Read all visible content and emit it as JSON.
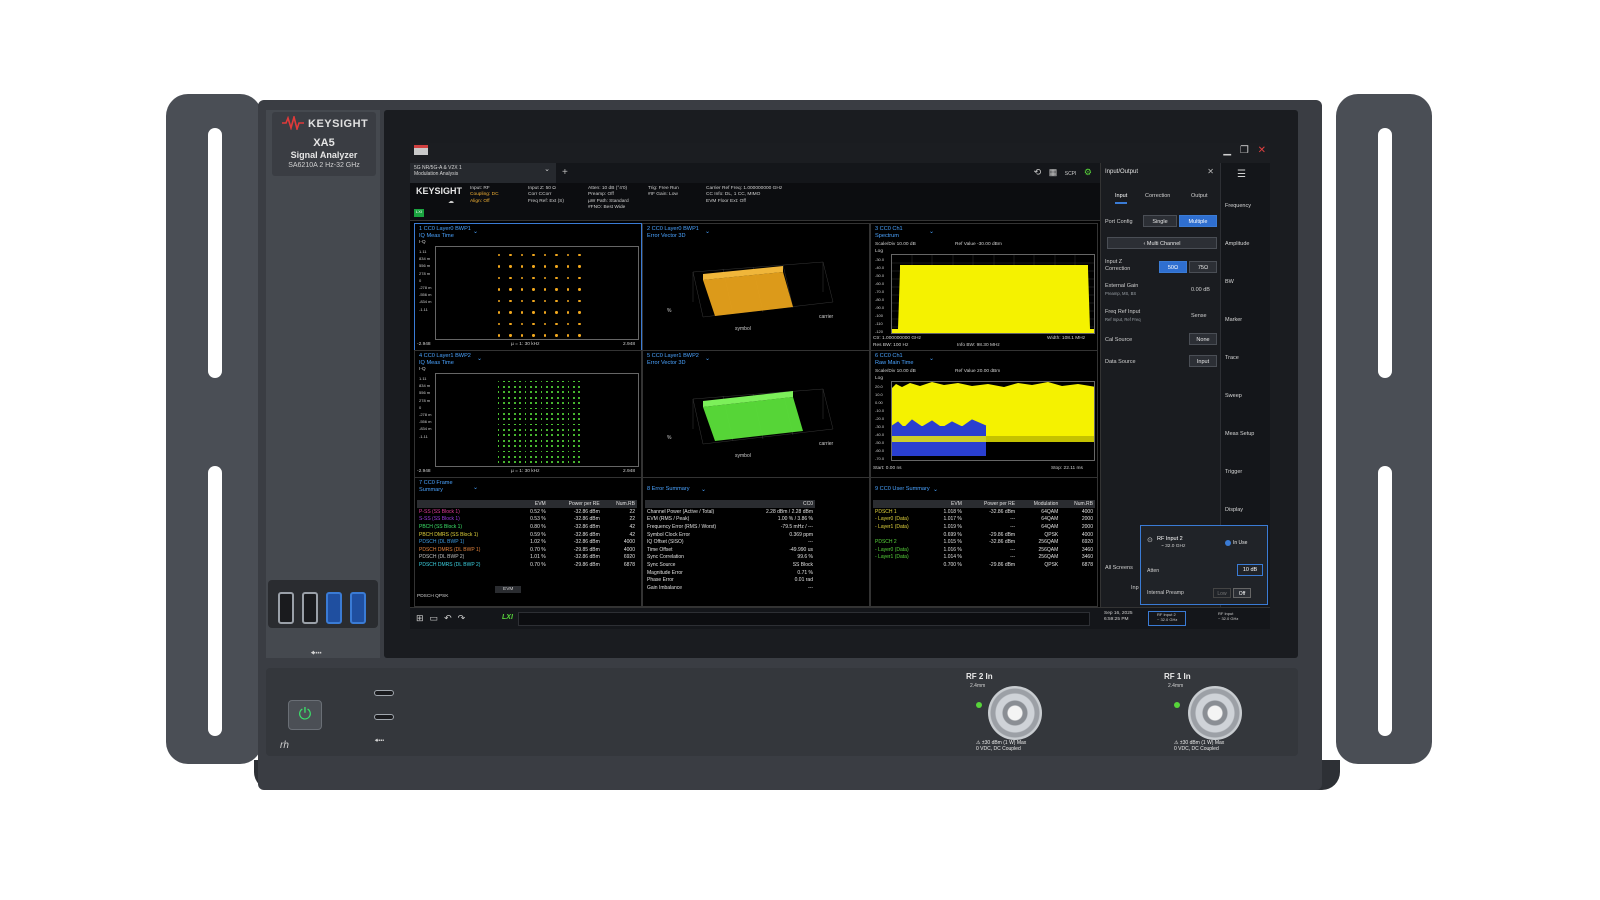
{
  "device": {
    "brand": "KEYSIGHT",
    "model": "XA5",
    "title": "Signal Analyzer",
    "spec": "SA6210A   2 Hz-32 GHz",
    "rh_mark": "rh",
    "front_inputs": [
      {
        "label": "RF 2 In",
        "sub": "2.4mm",
        "warning_1": "±30 dBm (1 W) Max",
        "warning_2": "0 VDC, DC Coupled"
      },
      {
        "label": "RF 1 In",
        "sub": "2.4mm",
        "warning_1": "±30 dBm (1 W) Max",
        "warning_2": "0 VDC, DC Coupled"
      }
    ]
  },
  "screen": {
    "mode_tab": {
      "line1": "5G NR/5G-A & V2X 1",
      "line2": "Modulation Analysis"
    },
    "settings_logo": "KEYSIGHT",
    "lxi": "LXI",
    "settings_groups": [
      {
        "lines": [
          "Input: RF",
          "Coupling: DC",
          "Align: Off"
        ],
        "highlight": [
          1,
          2
        ]
      },
      {
        "lines": [
          "Input Z: 50 Ω",
          "Corr CCorr",
          "Freq Ref: Ext (S)"
        ],
        "highlight": []
      },
      {
        "lines": [
          "Atten: 10 dB (°4'0)",
          "Preamp: Off",
          "µW Path: Standard",
          "#FNO: Best Wide"
        ],
        "highlight": []
      },
      {
        "lines": [
          "Trig: Free Run",
          "#IF Gain: Low"
        ],
        "highlight": []
      },
      {
        "lines": [
          "Carrier Ref Freq: 1.000000000 GHz",
          "CC Info: DL, 1 CC, MIMO",
          "EVM Floor Ext: Off"
        ],
        "highlight": []
      }
    ],
    "panes": [
      {
        "title": "1 CC0 Layer0 BWP1",
        "sub": "IQ Meas Time",
        "footer_left": "-2.948",
        "footer_mid": "µ = 1: 30 kHz",
        "footer_right": "2.948",
        "yaxis_label": "I-Q"
      },
      {
        "title": "2 CC0 Layer0 BWP1",
        "sub": "Error Vector 3D",
        "x_label": "symbol",
        "z_label": "carrier",
        "y_label": "%"
      },
      {
        "title": "3 CC0 Ch1",
        "sub": "Spectrum",
        "scale": "Scale/Div 10.00 dB",
        "ref": "Ref Value -30.00 dBm",
        "ctr": "Ctr: 1.000000000 GHz",
        "res_bw": "Res BW: 100 Hz",
        "info_bw": "Info BW: 98.30 MHz",
        "width": "Width: 108.1 MHz",
        "yaxis_label": "Log"
      },
      {
        "title": "4 CC0 Layer1 BWP2",
        "sub": "IQ Meas Time",
        "footer_left": "-2.948",
        "footer_mid": "µ = 1: 30 kHz",
        "footer_right": "2.948",
        "yaxis_label": "I-Q"
      },
      {
        "title": "5 CC0 Layer1 BWP2",
        "sub": "Error Vector 3D",
        "x_label": "symbol",
        "z_label": "carrier",
        "y_label": "%"
      },
      {
        "title": "6 CC0 Ch1",
        "sub": "Raw Main Time",
        "scale": "Scale/Div 10.00 dB",
        "ref": "Ref Value 20.00 dBm",
        "start": "Start: 0.00 ns",
        "stop": "Stop: 22.11 ms",
        "yaxis_label": "Log"
      }
    ],
    "iq_ticks": [
      "1.11",
      "834 m",
      "556 m",
      "278 m",
      "0",
      "-278 m",
      "-556 m",
      "-834 m",
      "-1.11"
    ],
    "spec_ticks": [
      "-30.0",
      "-40.0",
      "-50.0",
      "-60.0",
      "-70.0",
      "-80.0",
      "-90.0",
      "-100",
      "-110",
      "-120"
    ],
    "raw_ticks": [
      "20.0",
      "10.0",
      "0.00",
      "-10.0",
      "-20.0",
      "-30.0",
      "-40.0",
      "-50.0",
      "-60.0",
      "-70.0"
    ],
    "frame_summary": {
      "title": "7 CC0 Frame Summary",
      "columns": [
        "",
        "EVM",
        "Power per RE",
        "Num.RB"
      ],
      "rows": [
        [
          "P-SS (SS Block 1)",
          "0.52 %",
          "-32.86 dBm",
          "22"
        ],
        [
          "S-SS (SS Block 1)",
          "0.53 %",
          "-32.86 dBm",
          "22"
        ],
        [
          "PBCH (SS Block 1)",
          "0.80 %",
          "-32.86 dBm",
          "42"
        ],
        [
          "PBCH DMRS (SS Block 1)",
          "0.59 %",
          "-32.86 dBm",
          "42"
        ],
        [
          "PDSCH (DL BWP 1)",
          "1.02 %",
          "-32.86 dBm",
          "4000"
        ],
        [
          "PDSCH DMRS (DL BWP 1)",
          "0.70 %",
          "-29.85 dBm",
          "4000"
        ],
        [
          "PDSCH (DL BWP 2)",
          "1.01 %",
          "-32.86 dBm",
          "6920"
        ],
        [
          "PDSCH DMRS (DL BWP 2)",
          "0.70 %",
          "-29.86 dBm",
          "6878"
        ]
      ],
      "row_colors": [
        "#e23c9b",
        "#9b3ce2",
        "#3ce26a",
        "#e2d33c",
        "#3c9be2",
        "#e2823c",
        "#c0c0c0",
        "#3cd2e2"
      ],
      "footer": [
        "PDSCH QPSK",
        "EVM"
      ]
    },
    "error_summary": {
      "title": "8 Error Summary",
      "columns": [
        "",
        "CC0"
      ],
      "rows": [
        [
          "Channel Power (Active / Total)",
          "2.28 dBm / 2.28 dBm"
        ],
        [
          "EVM (RMS / Peak)",
          "1.00 % / 3.86 %"
        ],
        [
          "Frequency Error (RMS / Worst)",
          "-79.5 mHz / ---"
        ],
        [
          "Symbol Clock Error",
          "0.369 ppm"
        ],
        [
          "IQ Offset (SISO)",
          "---"
        ],
        [
          "Time Offset",
          "-49.990 us"
        ],
        [
          "Sync Correlation",
          "99.6 %"
        ],
        [
          "Sync Source",
          "SS Block"
        ],
        [
          "Magnitude Error",
          "0.71 %"
        ],
        [
          "Phase Error",
          "0.01 rad"
        ],
        [
          "Gain Imbalance",
          "---"
        ]
      ]
    },
    "user_summary": {
      "title": "9 CC0 User Summary",
      "columns": [
        "",
        "EVM",
        "Power per RE",
        "Modulation",
        "Num.RB"
      ],
      "rows": [
        [
          "PDSCH 1",
          "1.018 %",
          "-32.86 dBm",
          "64QAM",
          "4000"
        ],
        [
          "- Layer0 (Data)",
          "1.017 %",
          "---",
          "64QAM",
          "2000"
        ],
        [
          "- Layer1 (Data)",
          "1.019 %",
          "---",
          "64QAM",
          "2000"
        ],
        [
          "",
          "0.699 %",
          "-29.86 dBm",
          "QPSK",
          "4000"
        ],
        [
          "PDSCH 2",
          "1.015 %",
          "-32.86 dBm",
          "256QAM",
          "6920"
        ],
        [
          "- Layer0 (Data)",
          "1.016 %",
          "---",
          "256QAM",
          "3460"
        ],
        [
          "- Layer1 (Data)",
          "1.014 %",
          "---",
          "256QAM",
          "3460"
        ],
        [
          "",
          "0.700 %",
          "-29.86 dBm",
          "QPSK",
          "6878"
        ]
      ]
    },
    "side_panel": {
      "title": "Input/Output",
      "tabs": [
        "Input",
        "Correction",
        "Output"
      ],
      "port_config_label": "Port Config",
      "port_config_options": [
        "Single",
        "Multiple"
      ],
      "multi_channel": "Multi Channel",
      "input_z_label": "Input Z Correction",
      "input_z_options": [
        "50Ω",
        "75Ω"
      ],
      "ext_gain_label": "External Gain",
      "ext_gain_sub": "Preamp, MS, BS",
      "ext_gain_value": "0.00 dB",
      "freq_ref_label": "Freq Ref Input",
      "freq_ref_sub": "Ref Input, Ref Freq",
      "freq_ref_value": "Sense",
      "cal_source_label": "Cal Source",
      "cal_source_value": "None",
      "data_source_label": "Data Source",
      "data_source_value": "Input",
      "all_screens": "All Screens",
      "inp_stub": "Inp"
    },
    "menu": [
      "Frequency",
      "Amplitude",
      "BW",
      "Marker",
      "Trace",
      "Sweep",
      "Meas Setup",
      "Trigger",
      "Display"
    ],
    "popup": {
      "title": "RF Input 2",
      "sub": "~ 32.0 GHz",
      "status": "In Use",
      "atten_label": "Atten",
      "atten_value": "10 dB",
      "preamp_label": "Internal Preamp",
      "preamp_options": [
        "Low",
        "Off"
      ]
    },
    "status": {
      "date": "Sep 16, 2025",
      "time": "6:59:25 PM",
      "chips": [
        {
          "name": "RF Input 2",
          "freq": "~ 32.0 GHz"
        },
        {
          "name": "RF Input",
          "freq": "~ 32.0 GHz"
        }
      ]
    }
  },
  "colors": {
    "accent": "#3a7bd5",
    "trace_yellow": "#f5f200",
    "trace_blue": "#2a3fd0",
    "iq_orange": "#f2a81d",
    "iq_green": "#57e03a"
  }
}
